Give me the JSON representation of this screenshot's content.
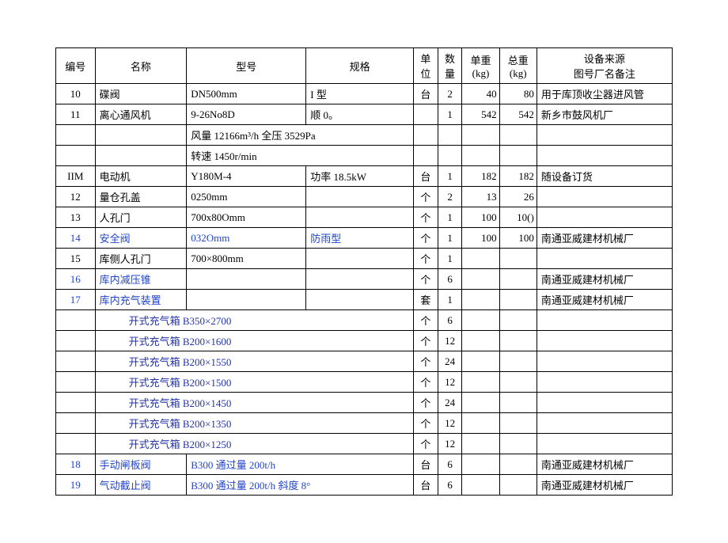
{
  "header": {
    "id": "编号",
    "name": "名称",
    "model": "型号",
    "spec": "规格",
    "unit": "单\n位",
    "qty": "数\n量",
    "uw": "单重\n(kg)",
    "tw": "总重\n(kg)",
    "src": "设备来源\n图号厂名备注"
  },
  "rows": [
    {
      "id": "10",
      "name": "碟阀",
      "model": "DN500mm",
      "spec": "I 型",
      "unit": "台",
      "qty": "2",
      "uw": "40",
      "tw": "80",
      "src": "用于库顶收尘器进风管"
    },
    {
      "id": "11",
      "name": "离心通风机",
      "model": "9-26No8D",
      "spec": "顺 0。",
      "unit": "",
      "qty": "1",
      "uw": "542",
      "tw": "542",
      "src": "新乡市鼓风机厂"
    },
    {
      "id": "",
      "name": "",
      "model": "风量 12166m³/h 全压 3529Pa",
      "spec": "",
      "unit": "",
      "qty": "",
      "uw": "",
      "tw": "",
      "src": "",
      "spanModelSpec": true
    },
    {
      "id": "",
      "name": "",
      "model": "转速 1450r/min",
      "spec": "",
      "unit": "",
      "qty": "",
      "uw": "",
      "tw": "",
      "src": "",
      "spanModelSpec": true
    },
    {
      "id": "IIM",
      "name": "电动机",
      "model": "Y180M-4",
      "spec": "功率 18.5kW",
      "unit": "台",
      "qty": "1",
      "uw": "182",
      "tw": "182",
      "src": "随设备订货"
    },
    {
      "id": "12",
      "name": "量仓孔盖",
      "model": "0250mm",
      "spec": "",
      "unit": "个",
      "qty": "2",
      "uw": "13",
      "tw": "26",
      "src": ""
    },
    {
      "id": "13",
      "name": "人孔门",
      "model": "700x80Omm",
      "spec": "",
      "unit": "个",
      "qty": "1",
      "uw": "100",
      "tw": "10()",
      "src": ""
    },
    {
      "id": "14",
      "name": "安全阀",
      "model": "032Omm",
      "spec": "防雨型",
      "unit": "个",
      "qty": "1",
      "uw": "100",
      "tw": "100",
      "src": "南通亚威建材机械厂",
      "blueId": true,
      "blueName": true,
      "blueModel": true,
      "blueSpec": true
    },
    {
      "id": "15",
      "name": "库侧人孔门",
      "model": "700×800mm",
      "spec": "",
      "unit": "个",
      "qty": "1",
      "uw": "",
      "tw": "",
      "src": ""
    },
    {
      "id": "16",
      "name": "库内减压锥",
      "model": "",
      "spec": "",
      "unit": "个",
      "qty": "6",
      "uw": "",
      "tw": "",
      "src": "南通亚威建材机械厂",
      "blueId": true,
      "blueName": true
    },
    {
      "id": "17",
      "name": "库内充气装置",
      "model": "",
      "spec": "",
      "unit": "套",
      "qty": "1",
      "uw": "",
      "tw": "",
      "src": "南通亚威建材机械厂",
      "blueId": true,
      "blueName": true
    },
    {
      "id": "",
      "name": "开式充气箱 B350×2700",
      "model": "",
      "spec": "",
      "unit": "个",
      "qty": "6",
      "uw": "",
      "tw": "",
      "src": "",
      "subrow": true,
      "blueName": true
    },
    {
      "id": "",
      "name": "开式充气箱 B200×1600",
      "model": "",
      "spec": "",
      "unit": "个",
      "qty": "12",
      "uw": "",
      "tw": "",
      "src": "",
      "subrow": true,
      "blueName": true
    },
    {
      "id": "",
      "name": "开式充气箱 B200×1550",
      "model": "",
      "spec": "",
      "unit": "个",
      "qty": "24",
      "uw": "",
      "tw": "",
      "src": "",
      "subrow": true,
      "blueName": true
    },
    {
      "id": "",
      "name": "开式充气箱 B200×1500",
      "model": "",
      "spec": "",
      "unit": "个",
      "qty": "12",
      "uw": "",
      "tw": "",
      "src": "",
      "subrow": true,
      "blueName": true
    },
    {
      "id": "",
      "name": "开式充气箱 B200×1450",
      "model": "",
      "spec": "",
      "unit": "个",
      "qty": "24",
      "uw": "",
      "tw": "",
      "src": "",
      "subrow": true,
      "blueName": true
    },
    {
      "id": "",
      "name": "开式充气箱 B200×1350",
      "model": "",
      "spec": "",
      "unit": "个",
      "qty": "12",
      "uw": "",
      "tw": "",
      "src": "",
      "subrow": true,
      "blueName": true
    },
    {
      "id": "",
      "name": "开式充气箱 B200×1250",
      "model": "",
      "spec": "",
      "unit": "个",
      "qty": "12",
      "uw": "",
      "tw": "",
      "src": "",
      "subrow": true,
      "blueName": true
    },
    {
      "id": "18",
      "name": "手动闸板阀",
      "model": "B300 通过量 200t/h",
      "spec": "",
      "unit": "台",
      "qty": "6",
      "uw": "",
      "tw": "",
      "src": "南通亚威建材机械厂",
      "blueId": true,
      "blueName": true,
      "blueModel": true,
      "spanModelSpec": true
    },
    {
      "id": "19",
      "name": "气动截止阀",
      "model": "B300 通过量 200t/h 斜度 8°",
      "spec": "",
      "unit": "台",
      "qty": "6",
      "uw": "",
      "tw": "",
      "src": "南通亚威建材机械厂",
      "blueId": true,
      "blueName": true,
      "blueModel": true,
      "spanModelSpec": true
    }
  ]
}
